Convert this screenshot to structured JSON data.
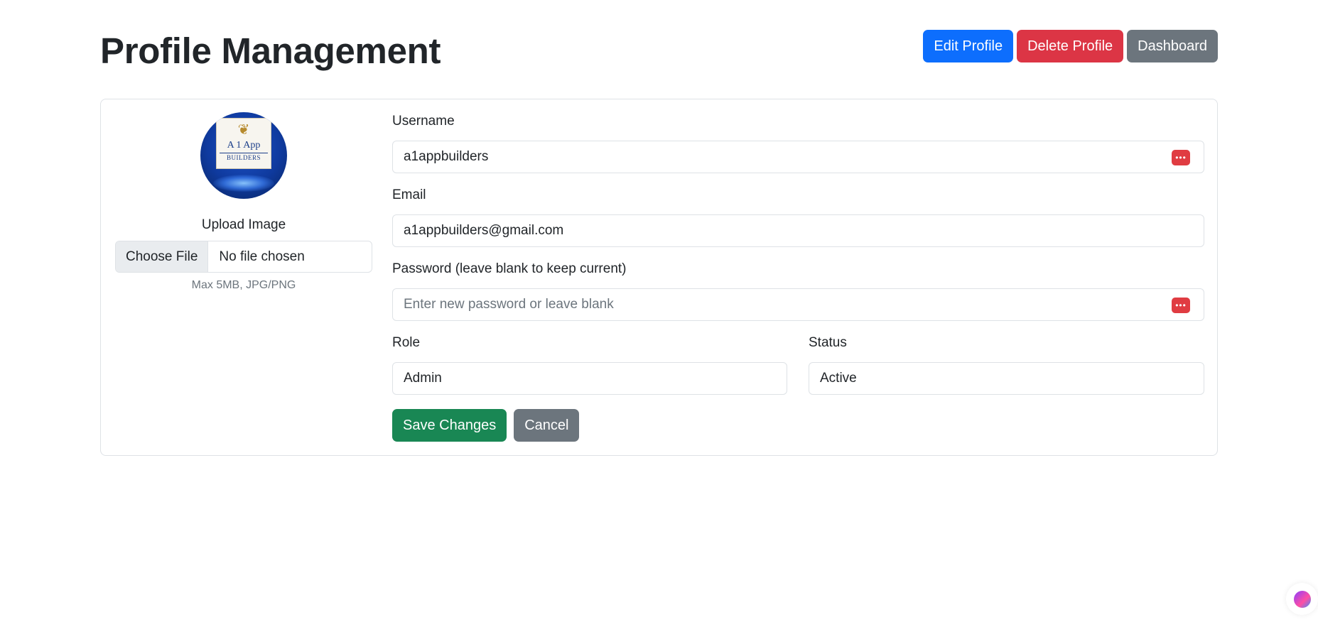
{
  "header": {
    "title": "Profile Management",
    "actions": {
      "edit_label": "Edit Profile",
      "delete_label": "Delete Profile",
      "dashboard_label": "Dashboard"
    }
  },
  "avatar": {
    "logo_text": "A 1 App",
    "logo_subtext": "BUILDERS"
  },
  "upload": {
    "label": "Upload Image",
    "button_label": "Choose File",
    "status": "No file chosen",
    "hint": "Max 5MB, JPG/PNG"
  },
  "form": {
    "username": {
      "label": "Username",
      "value": "a1appbuilders"
    },
    "email": {
      "label": "Email",
      "value": "a1appbuilders@gmail.com"
    },
    "password": {
      "label": "Password (leave blank to keep current)",
      "value": "",
      "placeholder": "Enter new password or leave blank"
    },
    "role": {
      "label": "Role",
      "value": "Admin"
    },
    "status": {
      "label": "Status",
      "value": "Active"
    },
    "save_label": "Save Changes",
    "cancel_label": "Cancel"
  },
  "icons": {
    "password_manager": "password-manager-icon",
    "assistant": "brain-icon"
  },
  "colors": {
    "primary": "#0d6efd",
    "danger": "#dc3545",
    "secondary": "#6c757d",
    "success": "#198754"
  }
}
